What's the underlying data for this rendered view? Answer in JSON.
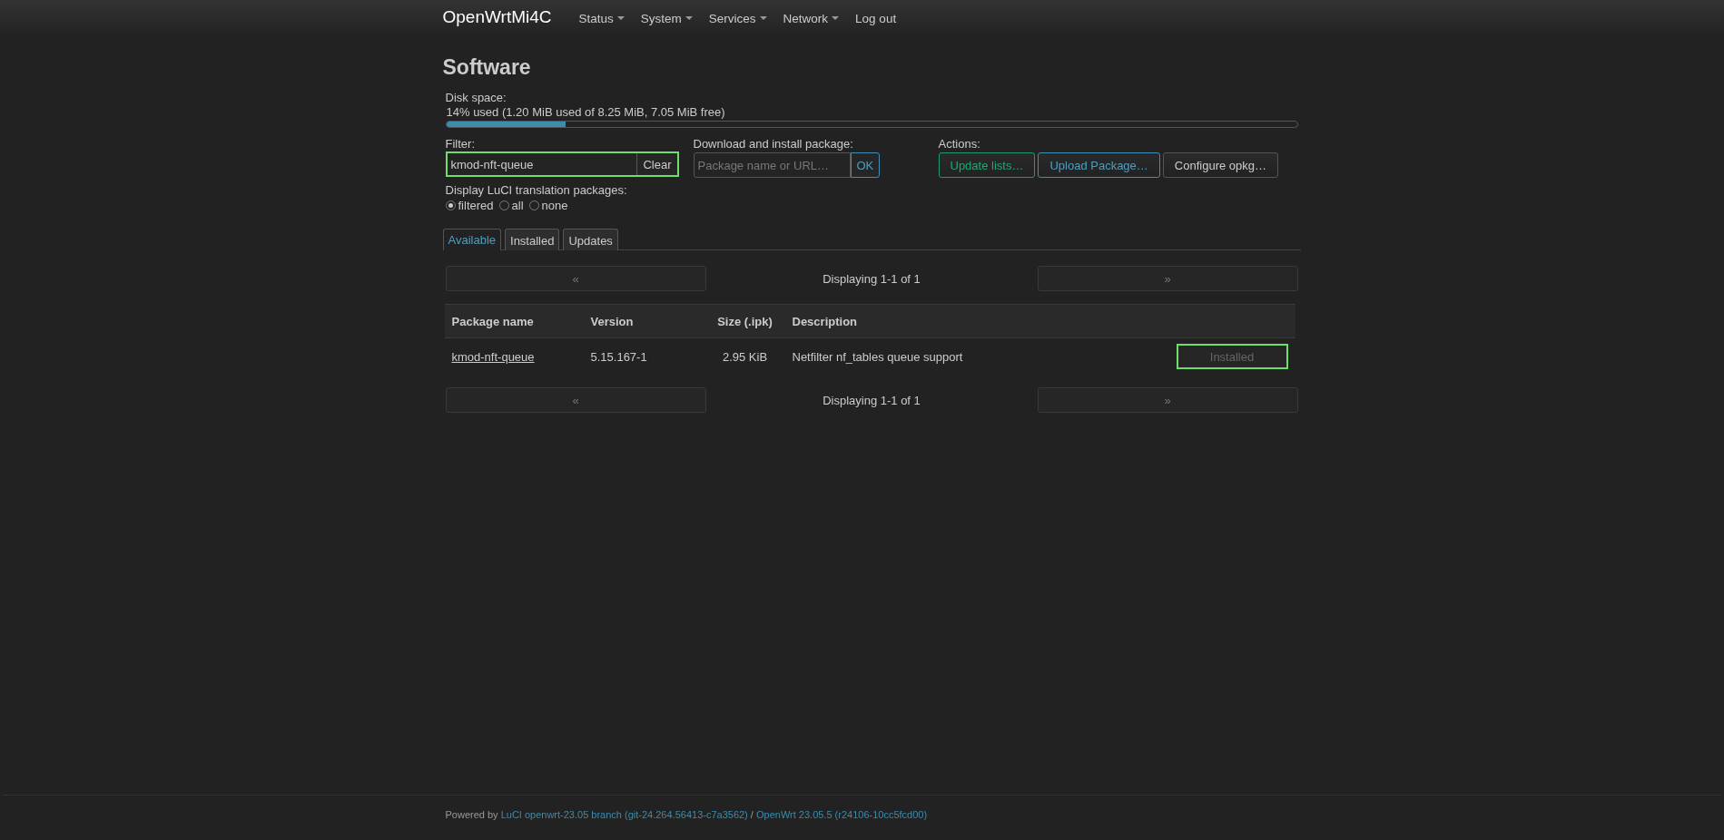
{
  "header": {
    "brand": "OpenWrtMi4C",
    "menu": [
      {
        "label": "Status",
        "dropdown": true
      },
      {
        "label": "System",
        "dropdown": true
      },
      {
        "label": "Services",
        "dropdown": true
      },
      {
        "label": "Network",
        "dropdown": true
      },
      {
        "label": "Log out",
        "dropdown": false
      }
    ]
  },
  "title": "Software",
  "disk": {
    "label": "Disk space:",
    "usage": "14% used (1.20 MiB used of 8.25 MiB, 7.05 MiB free)",
    "level": 0.14
  },
  "filter": {
    "label": "Filter:",
    "value": "kmod-nft-queue",
    "focused": true,
    "clear_button": "Clear"
  },
  "download": {
    "label": "Download and install package:",
    "placeholder": "Package name or URL…",
    "ok_button": "OK"
  },
  "actions": {
    "label": "Actions:",
    "buttons": [
      {
        "label": "Update lists…",
        "kind": "positive"
      },
      {
        "label": "Upload Package…",
        "kind": "action"
      },
      {
        "label": "Configure opkg…",
        "kind": "neutral"
      }
    ]
  },
  "translations": {
    "label": "Display LuCI translation packages:",
    "options": [
      {
        "label": "filtered",
        "selected": true
      },
      {
        "label": "all",
        "selected": false
      },
      {
        "label": "none",
        "selected": false
      }
    ]
  },
  "tabs": [
    {
      "label": "Available",
      "selected": true
    },
    {
      "label": "Installed",
      "selected": false
    },
    {
      "label": "Updates",
      "selected": false
    }
  ],
  "pager_top": {
    "prev": "«",
    "status": "Displaying 1-1 of 1",
    "next": "»"
  },
  "table": {
    "columns": [
      "Package name",
      "Version",
      "Size (.ipk)",
      "Description"
    ],
    "rows": [
      {
        "name": "kmod-nft-queue",
        "version": "5.15.167-1",
        "size": "2.95 KiB",
        "description": "Netfilter nf_tables queue support",
        "action": "Installed",
        "action_disabled": true,
        "action_focused": true
      }
    ]
  },
  "pager_bottom": {
    "prev": "«",
    "status": "Displaying 1-1 of 1",
    "next": "»"
  },
  "footer": {
    "prefix": "Powered by",
    "links": [
      "LuCI openwrt-23.05 branch (git-24.264.56413-c7a3562)",
      "OpenWrt 23.05.5 (r24106-10cc5fcd00)"
    ],
    "separator": "/"
  }
}
